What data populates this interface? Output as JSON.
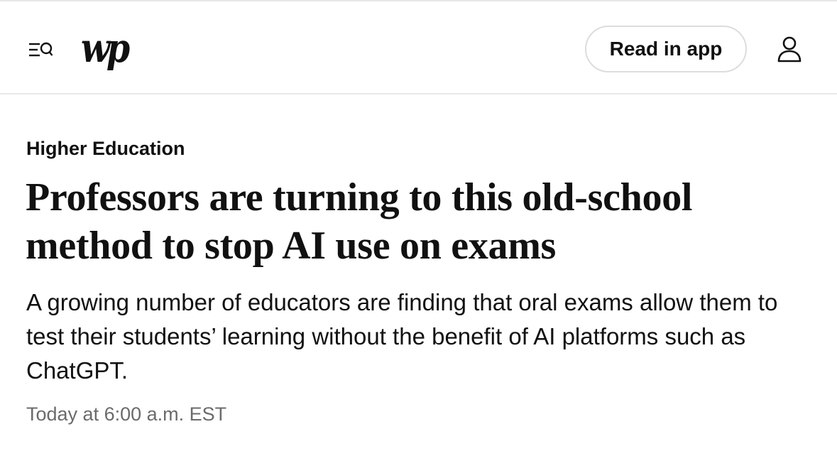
{
  "header": {
    "menu_icon": "menu-search-icon",
    "logo_text": "wp",
    "read_in_app_label": "Read in app",
    "profile_icon": "user-icon"
  },
  "article": {
    "section": "Higher Education",
    "headline": "Professors are turning to this old-school method to stop AI use on exams",
    "dek": "A growing number of educators are finding that oral exams allow them to test their students’ learning without the benefit of AI platforms such as ChatGPT.",
    "timestamp": "Today at 6:00 a.m. EST"
  },
  "colors": {
    "text": "#111111",
    "muted": "#6b6b6b",
    "border": "#dddddd",
    "background": "#ffffff"
  }
}
